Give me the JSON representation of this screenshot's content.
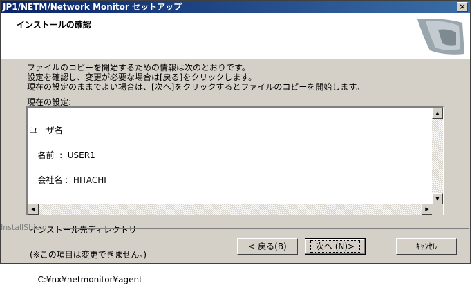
{
  "window": {
    "title": "JP1/NETM/Network Monitor セットアップ",
    "close_label": "×"
  },
  "header": {
    "title": "インストールの確認",
    "graphic_icon": "installshield-graphic-icon"
  },
  "description": {
    "lines": [
      "ファイルのコピーを開始するための情報は次のとおりです。",
      "設定を確認し、変更が必要な場合は[戻る]をクリックします。",
      "現在の設定のままでよい場合は、[次へ]をクリックするとファイルのコピーを開始します。"
    ]
  },
  "settings": {
    "label": "現在の設定:",
    "lines": [
      "ユーザ名",
      "   名前  :  USER1",
      "   会社名 :  HITACHI",
      "",
      "インストール先ディレクトリ",
      "(※この項目は変更できません。)",
      "   C:¥nx¥netmonitor¥agent"
    ]
  },
  "footer": {
    "brand": "InstallShield"
  },
  "buttons": {
    "back": "< 戻る(B)",
    "next": "次へ (N)>",
    "cancel": "ｷｬﾝｾﾙ"
  }
}
